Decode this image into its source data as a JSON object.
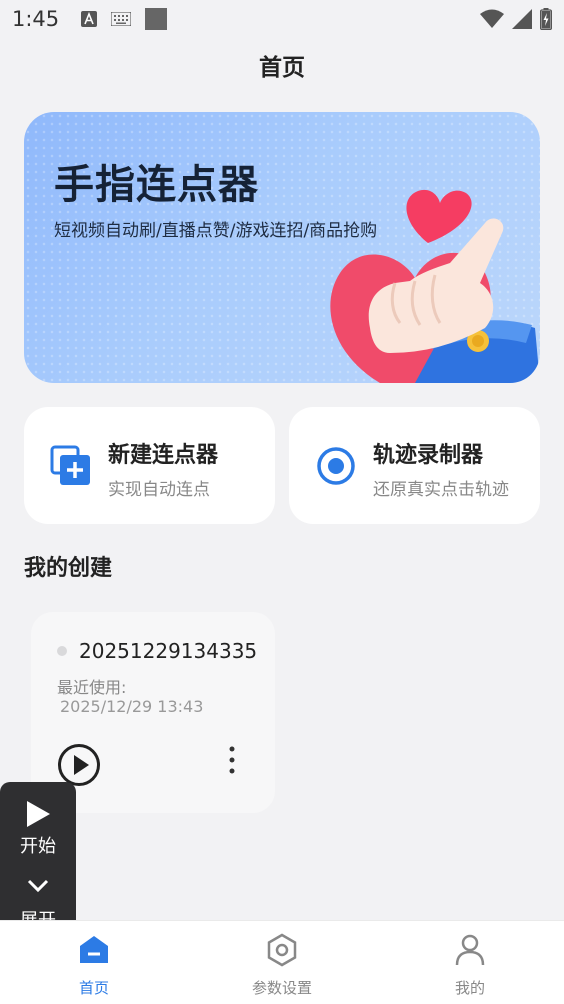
{
  "status_bar": {
    "time": "1:45"
  },
  "header": {
    "title": "首页"
  },
  "banner": {
    "title": "手指连点器",
    "subtitle": "短视频自动刷/直播点赞/游戏连招/商品抢购"
  },
  "features": [
    {
      "title": "新建连点器",
      "subtitle": "实现自动连点",
      "icon": "add-copy-icon"
    },
    {
      "title": "轨迹录制器",
      "subtitle": "还原真实点击轨迹",
      "icon": "record-target-icon"
    }
  ],
  "section": {
    "title": "我的创建"
  },
  "creation": {
    "name": "20251229134335",
    "last_used_label": "最近使用:",
    "last_used_date": "2025/12/29 13:43"
  },
  "float_panel": {
    "start_label": "开始",
    "expand_label": "展开"
  },
  "bottom_nav": [
    {
      "label": "首页",
      "icon": "home-icon",
      "active": true
    },
    {
      "label": "参数设置",
      "icon": "settings-hexagon-icon",
      "active": false
    },
    {
      "label": "我的",
      "icon": "person-icon",
      "active": false
    }
  ],
  "colors": {
    "accent": "#2c7be5",
    "background": "#f2f2f4",
    "float_panel": "#2f2f31"
  }
}
